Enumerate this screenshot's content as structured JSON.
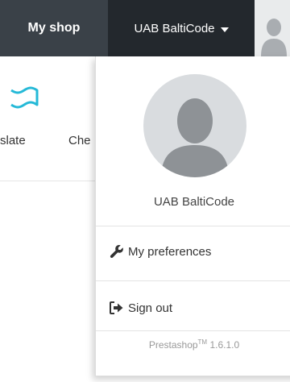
{
  "topbar": {
    "shop_label": "My shop",
    "account_label": "UAB BaltiCode"
  },
  "background": {
    "tabs": [
      {
        "label": "slate"
      },
      {
        "label": "Che"
      }
    ]
  },
  "dropdown": {
    "user_name": "UAB BaltiCode",
    "preferences_label": "My preferences",
    "signout_label": "Sign out",
    "footer_name": "Prestashop",
    "footer_tm": "TM",
    "footer_version": " 1.6.1.0"
  },
  "colors": {
    "topbar_bg": "#3a4148",
    "account_bg": "#23282d",
    "accent_icon": "#25b9d7"
  },
  "icons": [
    "caret-down-icon",
    "user-avatar-icon",
    "wrench-icon",
    "sign-out-icon",
    "translate-icon"
  ]
}
